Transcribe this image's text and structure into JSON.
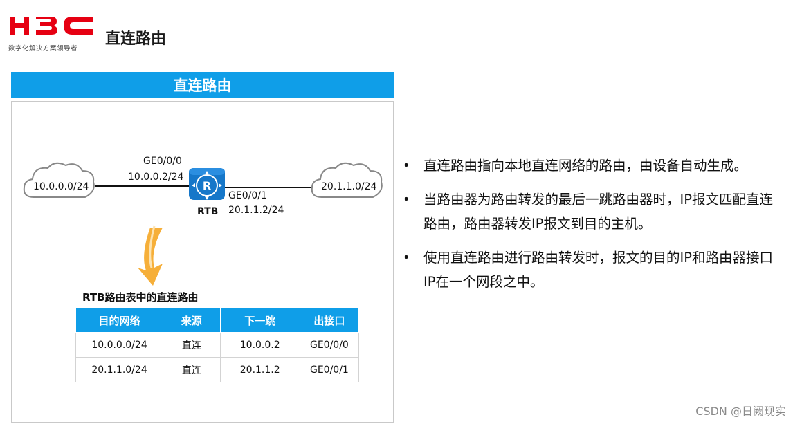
{
  "header": {
    "logo_text": "H3C",
    "logo_tagline": "数字化解决方案领导者",
    "page_title": "直连路由"
  },
  "section": {
    "title": "直连路由"
  },
  "topology": {
    "left_network": "10.0.0.0/24",
    "right_network": "20.1.1.0/24",
    "router_name": "RTB",
    "router_icon": "router-icon",
    "left_interface": "GE0/0/0",
    "left_interface_ip": "10.0.0.2/24",
    "right_interface": "GE0/0/1",
    "right_interface_ip": "20.1.1.2/24"
  },
  "routing_table": {
    "caption": "RTB路由表中的直连路由",
    "headers": [
      "目的网络",
      "来源",
      "下一跳",
      "出接口"
    ],
    "rows": [
      [
        "10.0.0.0/24",
        "直连",
        "10.0.0.2",
        "GE0/0/0"
      ],
      [
        "20.1.1.0/24",
        "直连",
        "20.1.1.2",
        "GE0/0/1"
      ]
    ]
  },
  "bullets": [
    "直连路由指向本地直连网络的路由，由设备自动生成。",
    "当路由器为路由转发的最后一跳路由器时，IP报文匹配直连路由，路由器转发IP报文到目的主机。",
    "使用直连路由进行路由转发时，报文的目的IP和路由器接口IP在一个网段之中。"
  ],
  "bullet_symbol": "•",
  "watermark": "CSDN @日阙现实",
  "colors": {
    "accent": "#0f9ee8",
    "logo_red": "#e60012",
    "arrow_orange": "#f5a623"
  }
}
